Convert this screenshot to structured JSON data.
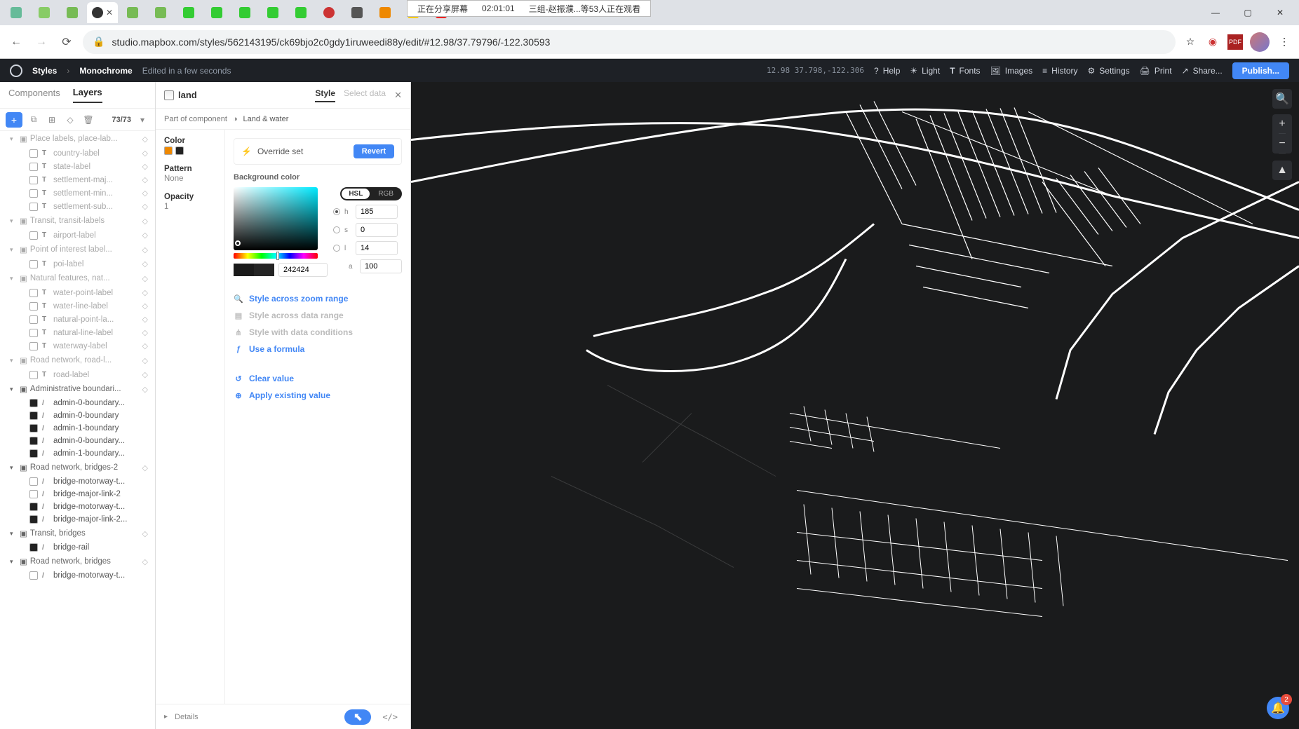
{
  "browser": {
    "share_status": "正在分享屏幕",
    "share_time": "02:01:01",
    "share_viewers": "三组-赵振濮...等53人正在观看",
    "url": "studio.mapbox.com/styles/562143195/ck69bjo2c0gdy1iruweedi88y/edit/#12.98/37.79796/-122.30593",
    "win_min": "—",
    "win_max": "▢",
    "win_close": "✕"
  },
  "topbar": {
    "crumb1": "Styles",
    "sep": "›",
    "crumb2": "Monochrome",
    "meta": "Edited in a few seconds",
    "coords": "12.98 37.798,-122.306",
    "help": "Help",
    "light": "Light",
    "fonts": "Fonts",
    "images": "Images",
    "history": "History",
    "settings": "Settings",
    "print": "Print",
    "share": "Share...",
    "publish": "Publish..."
  },
  "left": {
    "tab_components": "Components",
    "tab_layers": "Layers",
    "count": "73/73",
    "groups": [
      {
        "label": "Place labels, place-lab...",
        "dim": true,
        "items": [
          {
            "t": "T",
            "label": "country-label"
          },
          {
            "t": "T",
            "label": "state-label"
          },
          {
            "t": "T",
            "label": "settlement-maj..."
          },
          {
            "t": "T",
            "label": "settlement-min..."
          },
          {
            "t": "T",
            "label": "settlement-sub..."
          }
        ]
      },
      {
        "label": "Transit, transit-labels",
        "dim": true,
        "items": [
          {
            "t": "T",
            "label": "airport-label"
          }
        ]
      },
      {
        "label": "Point of interest label...",
        "dim": true,
        "items": [
          {
            "t": "T",
            "label": "poi-label"
          }
        ]
      },
      {
        "label": "Natural features, nat...",
        "dim": true,
        "items": [
          {
            "t": "T",
            "label": "water-point-label"
          },
          {
            "t": "T",
            "label": "water-line-label"
          },
          {
            "t": "T",
            "label": "natural-point-la..."
          },
          {
            "t": "T",
            "label": "natural-line-label"
          },
          {
            "t": "T",
            "label": "waterway-label"
          }
        ]
      },
      {
        "label": "Road network, road-l...",
        "dim": true,
        "items": [
          {
            "t": "T",
            "label": "road-label"
          }
        ]
      },
      {
        "label": "Administrative boundari...",
        "dim": false,
        "items": [
          {
            "t": "/",
            "label": "admin-0-boundary...",
            "sw": "dark"
          },
          {
            "t": "/",
            "label": "admin-0-boundary",
            "sw": "dark"
          },
          {
            "t": "/",
            "label": "admin-1-boundary",
            "sw": "dark"
          },
          {
            "t": "/",
            "label": "admin-0-boundary...",
            "sw": "dark"
          },
          {
            "t": "/",
            "label": "admin-1-boundary...",
            "sw": "dark"
          }
        ]
      },
      {
        "label": "Road network, bridges-2",
        "dim": false,
        "items": [
          {
            "t": "/",
            "label": "bridge-motorway-t..."
          },
          {
            "t": "/",
            "label": "bridge-major-link-2"
          },
          {
            "t": "/",
            "label": "bridge-motorway-t...",
            "sw": "dark"
          },
          {
            "t": "/",
            "label": "bridge-major-link-2...",
            "sw": "dark"
          }
        ]
      },
      {
        "label": "Transit, bridges",
        "dim": false,
        "items": [
          {
            "t": "/",
            "label": "bridge-rail",
            "sw": "dark"
          }
        ]
      },
      {
        "label": "Road network, bridges",
        "dim": false,
        "items": [
          {
            "t": "/",
            "label": "bridge-motorway-t..."
          }
        ]
      }
    ]
  },
  "mid": {
    "layer_name": "land",
    "tab_style": "Style",
    "tab_data": "Select data",
    "partof": "Part of component",
    "partof_val": "Land & water",
    "props": {
      "color_k": "Color",
      "pattern_k": "Pattern",
      "pattern_v": "None",
      "opacity_k": "Opacity",
      "opacity_v": "1"
    },
    "override": "Override set",
    "revert": "Revert",
    "pick_label": "Background color",
    "mode_hsl": "HSL",
    "mode_rgb": "RGB",
    "h": "185",
    "s": "0",
    "l": "14",
    "a": "100",
    "hex": "242424",
    "act_zoom": "Style across zoom range",
    "act_data": "Style across data range",
    "act_cond": "Style with data conditions",
    "act_formula": "Use a formula",
    "act_clear": "Clear value",
    "act_apply": "Apply existing value",
    "details": "Details",
    "code": "</>"
  },
  "map": {
    "search": "🔍",
    "plus": "+",
    "minus": "−",
    "compass": "▲",
    "bell_badge": "2"
  }
}
